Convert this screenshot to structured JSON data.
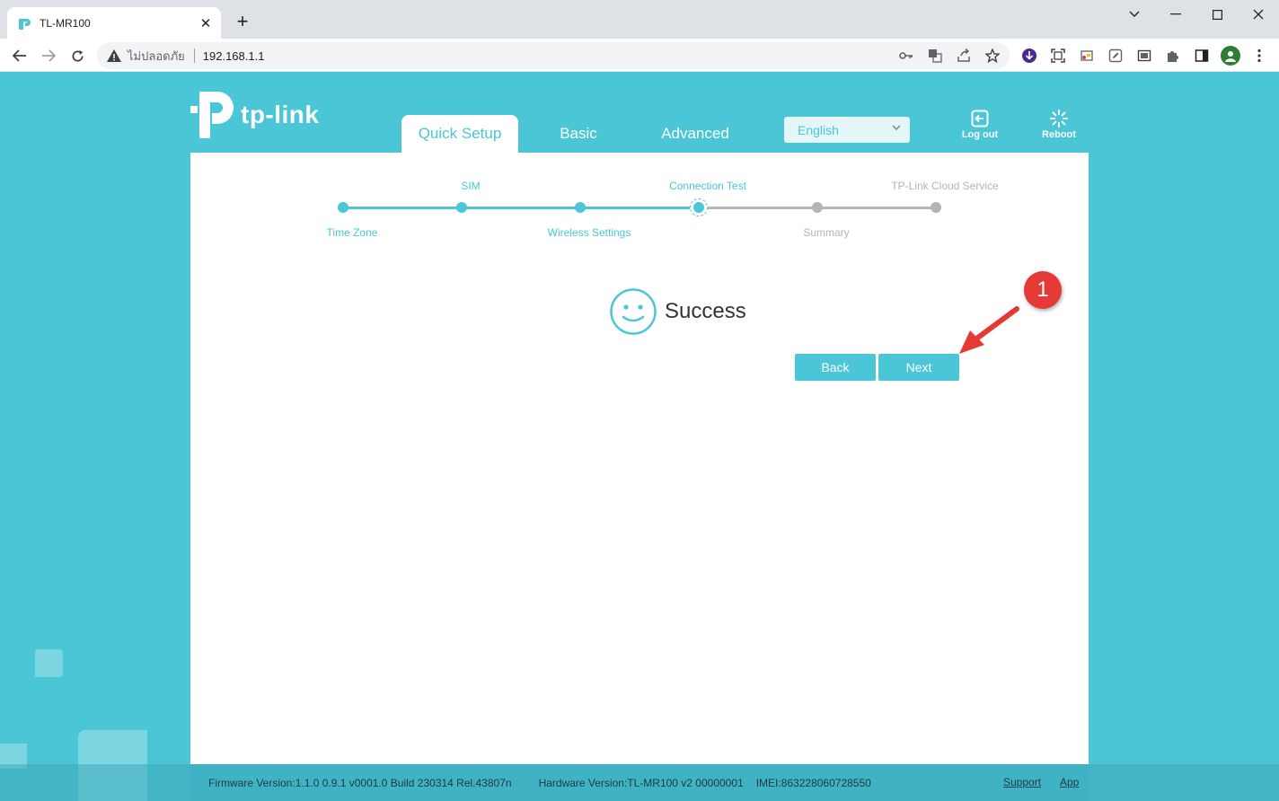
{
  "browser": {
    "tab_title": "TL-MR100",
    "new_tab_label": "+",
    "insecure_label": "ไม่ปลอดภัย",
    "url": "192.168.1.1"
  },
  "header": {
    "brand": "tp-link",
    "tabs": [
      {
        "label": "Quick Setup",
        "active": true
      },
      {
        "label": "Basic",
        "active": false
      },
      {
        "label": "Advanced",
        "active": false
      }
    ],
    "language": "English",
    "logout_label": "Log out",
    "reboot_label": "Reboot"
  },
  "steps": [
    {
      "label": "Time Zone",
      "position": "bottom",
      "state": "done"
    },
    {
      "label": "SIM",
      "position": "top",
      "state": "done"
    },
    {
      "label": "Wireless Settings",
      "position": "bottom",
      "state": "done"
    },
    {
      "label": "Connection Test",
      "position": "top",
      "state": "current"
    },
    {
      "label": "Summary",
      "position": "bottom",
      "state": "pending"
    },
    {
      "label": "TP-Link Cloud Service",
      "position": "top",
      "state": "pending"
    }
  ],
  "result": {
    "message": "Success"
  },
  "buttons": {
    "back_label": "Back",
    "next_label": "Next"
  },
  "annotation": {
    "badge_number": "1"
  },
  "footer": {
    "firmware": "Firmware Version:1.1.0 0.9.1 v0001.0 Build 230314 Rel.43807n",
    "hardware": "Hardware Version:TL-MR100 v2 00000001",
    "imei": "IMEI:863228060728550",
    "support_label": "Support",
    "app_label": "App"
  },
  "colors": {
    "accent": "#4ac6d6",
    "pending": "#b4b4b4",
    "badge": "#e53935"
  }
}
